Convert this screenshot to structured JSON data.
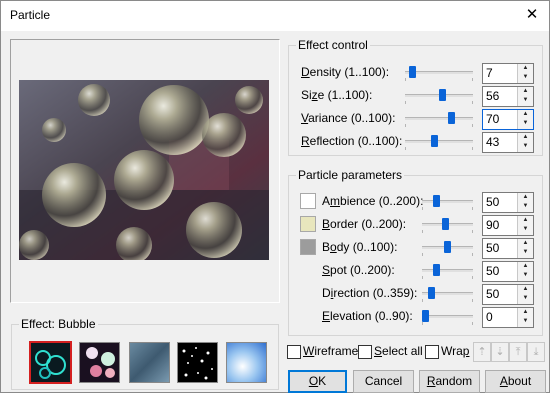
{
  "window": {
    "title": "Particle",
    "close_glyph": "✕"
  },
  "effect": {
    "group_label": "Effect: Bubble"
  },
  "effect_control": {
    "label": "Effect control",
    "rows": [
      {
        "pre": "",
        "key": "D",
        "post": "ensity (1..100):",
        "value": "7",
        "level": 0.06
      },
      {
        "pre": "Si",
        "key": "z",
        "post": "e (1..100):",
        "value": "56",
        "level": 0.55
      },
      {
        "pre": "",
        "key": "V",
        "post": "ariance (0..100):",
        "value": "70",
        "level": 0.7
      },
      {
        "pre": "",
        "key": "R",
        "post": "eflection (0..100):",
        "value": "43",
        "level": 0.43
      }
    ]
  },
  "particle_parameters": {
    "label": "Particle parameters",
    "rows": [
      {
        "pre": "A",
        "key": "m",
        "post": "bience (0..200):",
        "value": "50",
        "level": 0.25,
        "swatch": "#ffffff"
      },
      {
        "pre": "",
        "key": "B",
        "post": "order (0..200):",
        "value": "90",
        "level": 0.45,
        "swatch": "#e8e6bd"
      },
      {
        "pre": "B",
        "key": "o",
        "post": "dy (0..100):",
        "value": "50",
        "level": 0.5,
        "swatch": "#9c9c9c"
      },
      {
        "pre": "",
        "key": "S",
        "post": "pot (0..200):",
        "value": "50",
        "level": 0.25,
        "swatch": ""
      },
      {
        "pre": "D",
        "key": "i",
        "post": "rection (0..359):",
        "value": "50",
        "level": 0.14,
        "swatch": ""
      },
      {
        "pre": "",
        "key": "E",
        "post": "levation (0..90):",
        "value": "0",
        "level": 0.0,
        "swatch": ""
      }
    ]
  },
  "options": {
    "wireframe": {
      "pre": "",
      "key": "W",
      "post": "ireframe"
    },
    "select_all": {
      "pre": "",
      "key": "S",
      "post": "elect all"
    },
    "wrap": {
      "pre": "Wra",
      "key": "p",
      "post": ""
    }
  },
  "buttons": {
    "ok": {
      "pre": "",
      "key": "O",
      "post": "K"
    },
    "cancel": {
      "pre": "Cancel",
      "key": "",
      "post": ""
    },
    "random": {
      "pre": "",
      "key": "R",
      "post": "andom"
    },
    "about": {
      "pre": "",
      "key": "A",
      "post": "bout"
    }
  },
  "arrow_buttons": [
    "⇡",
    "⇣",
    "⤒",
    "⤓"
  ],
  "icons": {
    "close": "close-icon",
    "thumbnails": [
      "bubble-effect-icon",
      "sparkle-effect-icon",
      "rain-effect-icon",
      "snow-effect-icon",
      "cloud-effect-icon"
    ]
  },
  "colors": {
    "slider_thumb": "#0a64d8",
    "selected_border": "#d42020",
    "default_button": "#0078d7"
  }
}
